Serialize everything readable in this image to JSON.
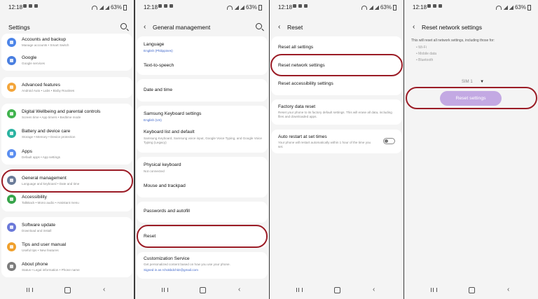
{
  "status": {
    "time": "12:18",
    "battery": "63%"
  },
  "panel1": {
    "title": "Settings",
    "items": [
      {
        "title": "Accounts and backup",
        "sub": "Manage accounts  •  Smart Switch",
        "color": "#4d85e8"
      },
      {
        "title": "Google",
        "sub": "Google services",
        "color": "#4a7fe0"
      },
      {
        "title": "Advanced features",
        "sub": "Android Auto  •  Labs  •  Bixby Routines",
        "color": "#f3a53a"
      },
      {
        "title": "Digital Wellbeing and parental controls",
        "sub": "Screen time  •  App timers  •  Bedtime mode",
        "color": "#41b34e"
      },
      {
        "title": "Battery and device care",
        "sub": "Storage  •  Memory  •  Device protection",
        "color": "#2bb3a1"
      },
      {
        "title": "Apps",
        "sub": "Default apps  •  App settings",
        "color": "#5b8ef0"
      },
      {
        "title": "General management",
        "sub": "Language and keyboard  •  Date and time",
        "color": "#6a7b98"
      },
      {
        "title": "Accessibility",
        "sub": "TalkBack  •  Mono audio  •  Assistant menu",
        "color": "#37a44a"
      },
      {
        "title": "Software update",
        "sub": "Download and install",
        "color": "#6b79d9"
      },
      {
        "title": "Tips and user manual",
        "sub": "Useful tips  •  New features",
        "color": "#f0a02c"
      },
      {
        "title": "About phone",
        "sub": "Status  •  Legal information  •  Phone name",
        "color": "#7c7c7c"
      }
    ]
  },
  "panel2": {
    "title": "General management",
    "items": [
      {
        "title": "Language",
        "sub": "English (Philippines)"
      },
      {
        "title": "Text-to-speech",
        "sub": ""
      },
      {
        "title": "Date and time",
        "sub": ""
      },
      {
        "title": "Samsung Keyboard settings",
        "sub": "English (US)"
      },
      {
        "title": "Keyboard list and default",
        "sub": "Samsung Keyboard, Samsung voice input, Google Voice Typing, and Google Voice Typing (Legacy)"
      },
      {
        "title": "Physical keyboard",
        "sub": "Not connected"
      },
      {
        "title": "Mouse and trackpad",
        "sub": ""
      },
      {
        "title": "Passwords and autofill",
        "sub": ""
      },
      {
        "title": "Reset",
        "sub": ""
      },
      {
        "title": "Customization Service",
        "sub": "Get personalized content based on how you use your phone.",
        "sub2": "Signed in as rchokbdchitz@gmail.com"
      }
    ]
  },
  "panel3": {
    "title": "Reset",
    "items": [
      {
        "title": "Reset all settings",
        "sub": ""
      },
      {
        "title": "Reset network settings",
        "sub": ""
      },
      {
        "title": "Reset accessibility settings",
        "sub": ""
      },
      {
        "title": "Factory data reset",
        "sub": "Reset your phone to its factory default settings. This will erase all data, including files and downloaded apps."
      },
      {
        "title": "Auto restart at set times",
        "sub": "Your phone will restart automatically within 1 hour of the time you set."
      }
    ]
  },
  "panel4": {
    "title": "Reset network settings",
    "intro": "This will reset all network settings, including those for:",
    "bullets": [
      "• Wi-Fi",
      "• Mobile data",
      "• Bluetooth"
    ],
    "sim": "SIM 1",
    "button": "Reset settings"
  },
  "colors": {
    "highlight": "#9b1c26",
    "button": "#c3a9e3"
  }
}
